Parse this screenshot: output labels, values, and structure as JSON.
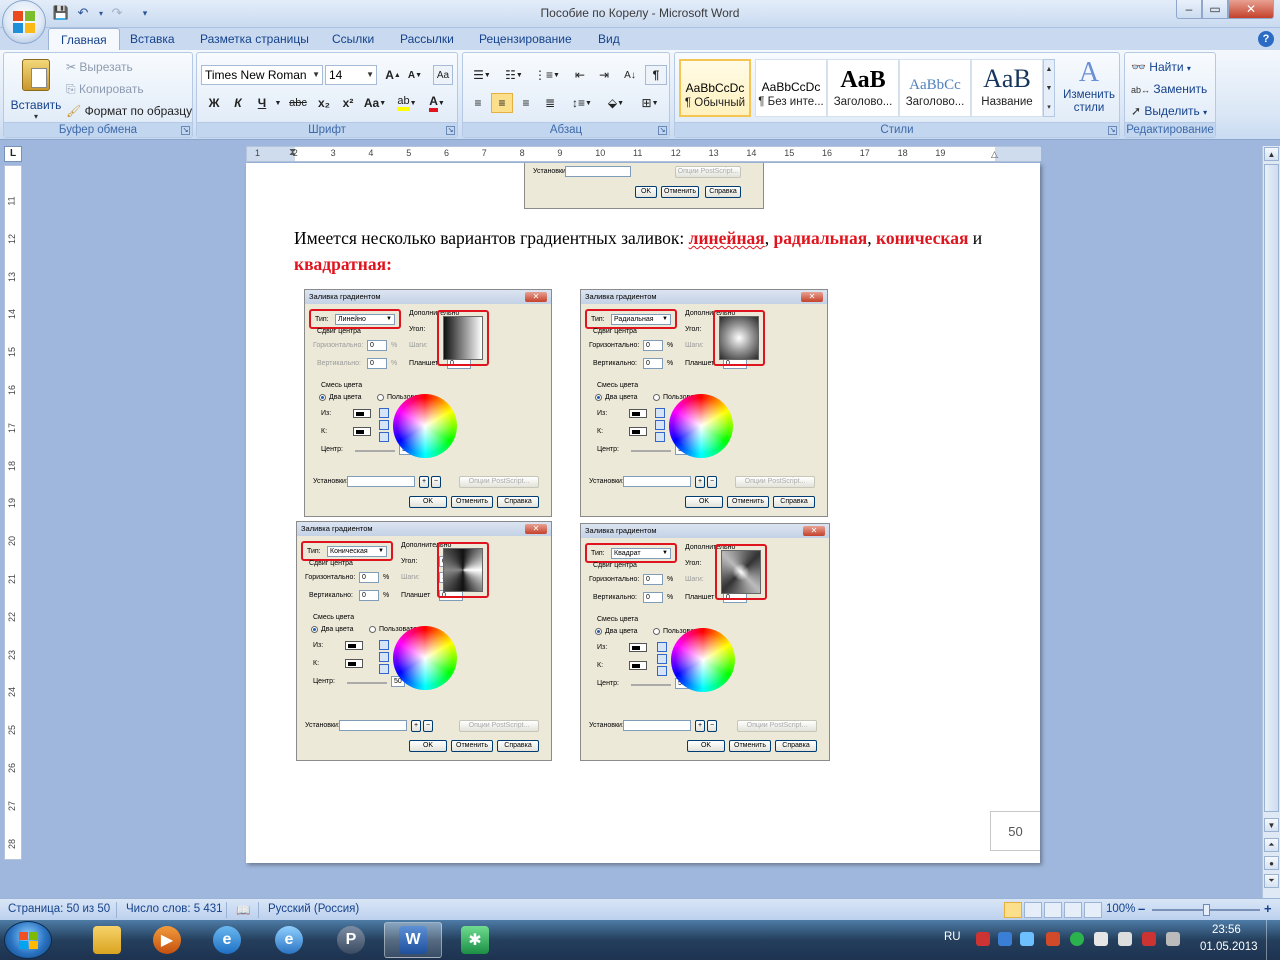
{
  "window": {
    "title": "Пособие по Корелу - Microsoft Word",
    "controls": [
      "–",
      "▭",
      "✕"
    ]
  },
  "tabs": [
    {
      "label": "Главная",
      "active": true
    },
    {
      "label": "Вставка"
    },
    {
      "label": "Разметка страницы"
    },
    {
      "label": "Ссылки"
    },
    {
      "label": "Рассылки"
    },
    {
      "label": "Рецензирование"
    },
    {
      "label": "Вид"
    }
  ],
  "ribbon": {
    "clipboard": {
      "label": "Буфер обмена",
      "paste": "Вставить",
      "cut": "Вырезать",
      "copy": "Копировать",
      "format_painter": "Формат по образцу"
    },
    "font": {
      "label": "Шрифт",
      "font_name": "Times New Roman",
      "font_size": "14",
      "bold": "Ж",
      "italic": "К",
      "underline": "Ч",
      "strike": "abc",
      "sub": "x₂",
      "sup": "x²",
      "case": "Aa",
      "grow": "A",
      "shrink": "A"
    },
    "paragraph": {
      "label": "Абзац"
    },
    "styles": {
      "label": "Стили",
      "items": [
        {
          "sample": "AaBbCcDc",
          "name": "¶ Обычный",
          "selected": true
        },
        {
          "sample": "AaBbCcDc",
          "name": "¶ Без инте..."
        },
        {
          "sample": "AaB",
          "name": "Заголово..."
        },
        {
          "sample": "AaBbCc",
          "name": "Заголово..."
        },
        {
          "sample": "AaB",
          "name": "Название"
        }
      ],
      "change_styles": "Изменить стили"
    },
    "editing": {
      "label": "Редактирование",
      "find": "Найти",
      "replace": "Заменить",
      "select": "Выделить"
    }
  },
  "ruler": {
    "h_ticks": [
      "1",
      "2",
      "3",
      "4",
      "5",
      "6",
      "7",
      "8",
      "9",
      "10",
      "11",
      "12",
      "13",
      "14",
      "15",
      "16",
      "17",
      "18",
      "19"
    ],
    "v_ticks": [
      "11",
      "12",
      "13",
      "14",
      "15",
      "16",
      "17",
      "18",
      "19",
      "20",
      "21",
      "22",
      "23",
      "24",
      "25",
      "26",
      "27",
      "28"
    ]
  },
  "document": {
    "text_parts": [
      {
        "t": "Имеется несколько вариантов градиентных заливок: ",
        "style": "normal"
      },
      {
        "t": "линейная",
        "style": "red-squig"
      },
      {
        "t": ", ",
        "style": "normal"
      },
      {
        "t": "радиальная",
        "style": "red"
      },
      {
        "t": ", ",
        "style": "normal"
      },
      {
        "t": "коническая",
        "style": "red"
      },
      {
        "t": " и ",
        "style": "normal"
      },
      {
        "t": "квадратная:",
        "style": "red"
      }
    ],
    "page_number": "50",
    "top_dialog_fragment": {
      "settings": "Установки:",
      "postscript": "Опции PostScript...",
      "ok": "OK",
      "cancel": "Отменить",
      "help": "Справка"
    },
    "dialogs": [
      {
        "title": "Заливка градиентом",
        "type_label": "Тип:",
        "type_value": "Линейно",
        "preview": "linear",
        "disabled_center": true,
        "angle": "0,0",
        "steps": "256",
        "edge": "0"
      },
      {
        "title": "Заливка градиентом",
        "type_label": "Тип:",
        "type_value": "Радиальная",
        "preview": "radial",
        "disabled_center": false,
        "angle": "0,0",
        "steps": "256",
        "edge": "0"
      },
      {
        "title": "Заливка градиентом",
        "type_label": "Тип:",
        "type_value": "Коническая",
        "preview": "conical",
        "disabled_center": false,
        "angle": "0,0",
        "steps": "256",
        "edge": "0"
      },
      {
        "title": "Заливка градиентом",
        "type_label": "Тип:",
        "type_value": "Квадрат",
        "preview": "square",
        "disabled_center": false,
        "angle": "0,0",
        "steps": "256",
        "edge": "0"
      }
    ],
    "dialog_labels": {
      "extra": "Дополнительно",
      "center_shift": "Сдвиг центра",
      "horizontal": "Горизонтально:",
      "vertical": "Вертикально:",
      "angle": "Угол:",
      "steps": "Шаги:",
      "edge": "Планшет",
      "horizontal_value": "0",
      "vertical_value": "0",
      "pct": "%",
      "color_blend": "Смесь цвета",
      "two_colors": "Два цвета",
      "custom": "Пользователь",
      "from": "Из:",
      "to": "К:",
      "center": "Центр:",
      "center_value": "50",
      "settings": "Установки:",
      "postscript": "Опции PostScript...",
      "ok": "OK",
      "cancel": "Отменить",
      "help": "Справка"
    }
  },
  "status": {
    "page": "Страница: 50 из 50",
    "words": "Число слов: 5 431",
    "language": "Русский (Россия)",
    "zoom": "100%",
    "zoom_level_pct": 50
  },
  "taskbar": {
    "lang": "RU",
    "time": "23:56",
    "date": "01.05.2013"
  },
  "colors": {
    "accent_red": "#e0141e",
    "ribbon_text": "#15428b",
    "workspace": "#9fb7dc"
  }
}
